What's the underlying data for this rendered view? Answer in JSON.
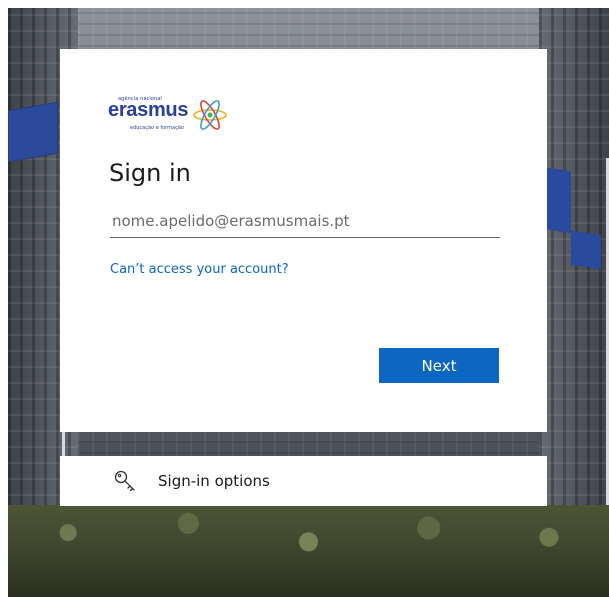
{
  "logo": {
    "top_text": "agência nacional",
    "word": "erasmus",
    "sub_text": "educação e formação"
  },
  "signin": {
    "title": "Sign in",
    "email_placeholder": "nome.apelido@erasmusmais.pt",
    "email_value": "",
    "cant_access": "Can’t access your account?",
    "next_label": "Next"
  },
  "options": {
    "label": "Sign-in options",
    "icon": "key-icon"
  },
  "colors": {
    "accent": "#0b67c2",
    "brand": "#2a3f99"
  }
}
